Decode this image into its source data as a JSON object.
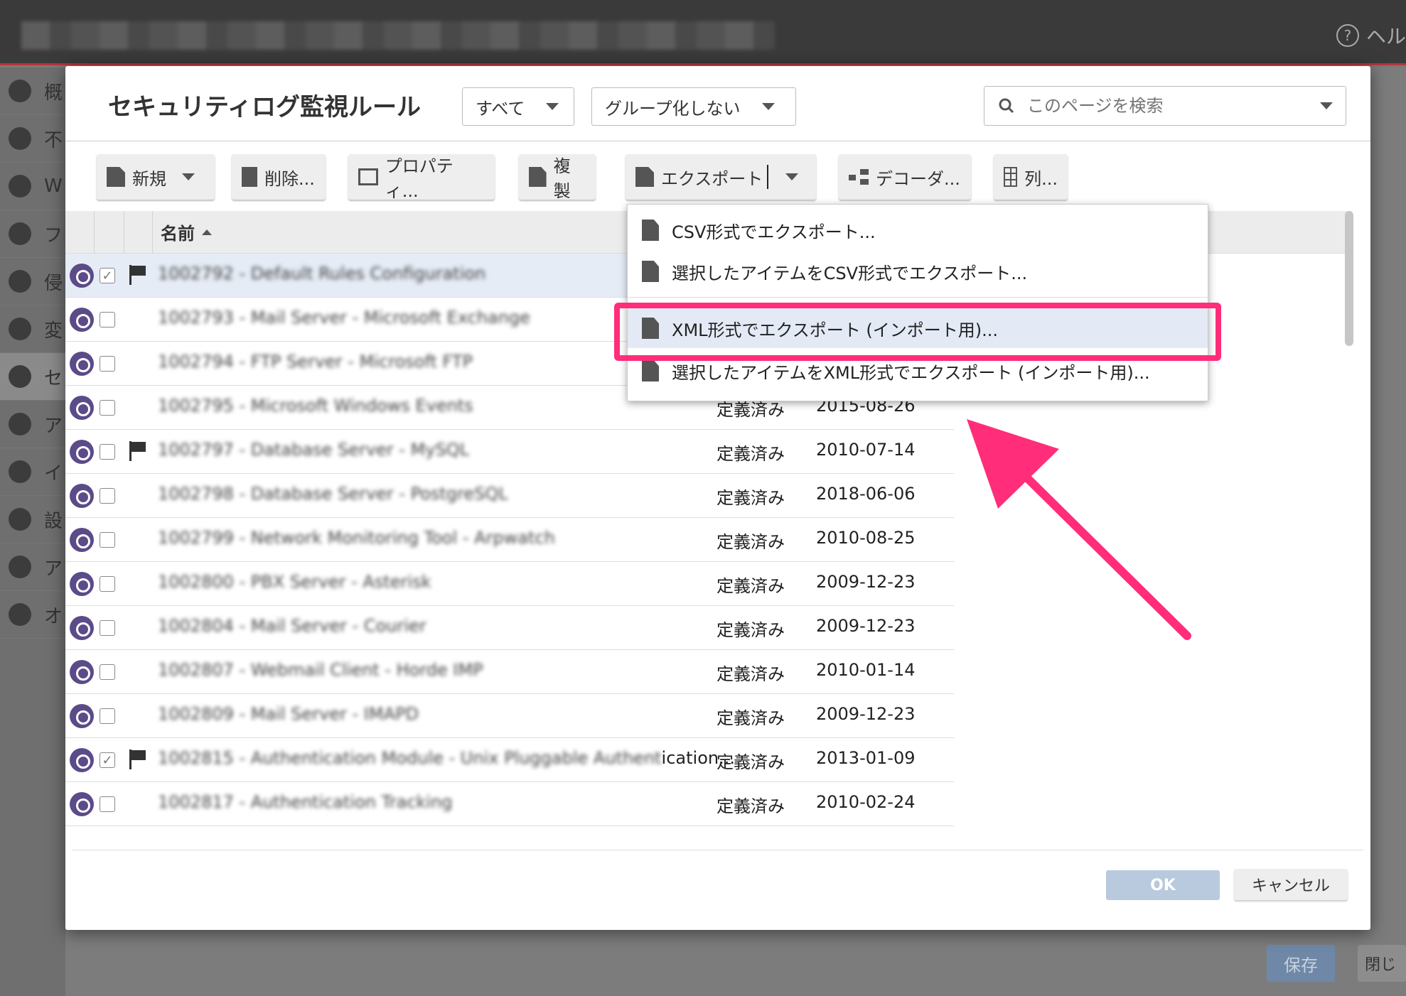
{
  "topbar": {
    "help_label": "ヘル"
  },
  "leftnav": {
    "items": [
      "概",
      "不",
      "W",
      "フ",
      "侵",
      "変",
      "セ",
      "ア",
      "イ",
      "設",
      "ア",
      "オ"
    ]
  },
  "background": {
    "save_label": "保存",
    "close_label": "閉じ"
  },
  "dialog": {
    "title": "セキュリティログ監視ルール",
    "filter_value": "すべて",
    "group_value": "グループ化しない",
    "search_placeholder": "このページを検索"
  },
  "toolbar": {
    "new_label": "新規",
    "delete_label": "削除...",
    "properties_label": "プロパティ...",
    "duplicate_label": "複製",
    "export_label": "エクスポート",
    "decoder_label": "デコーダ...",
    "columns_label": "列..."
  },
  "table": {
    "name_header": "名前",
    "rows": [
      {
        "name": "1002792 - Default Rules Configuration",
        "status": "",
        "date": "",
        "checked": true,
        "flag": true
      },
      {
        "name": "1002793 - Mail Server - Microsoft Exchange",
        "status": "",
        "date": "",
        "checked": false,
        "flag": false
      },
      {
        "name": "1002794 - FTP Server - Microsoft FTP",
        "status": "",
        "date": "",
        "checked": false,
        "flag": false
      },
      {
        "name": "1002795 - Microsoft Windows Events",
        "status": "定義済み",
        "date": "2015-08-26",
        "checked": false,
        "flag": false
      },
      {
        "name": "1002797 - Database Server - MySQL",
        "status": "定義済み",
        "date": "2010-07-14",
        "checked": false,
        "flag": true
      },
      {
        "name": "1002798 - Database Server - PostgreSQL",
        "status": "定義済み",
        "date": "2018-06-06",
        "checked": false,
        "flag": false
      },
      {
        "name": "1002799 - Network Monitoring Tool - Arpwatch",
        "status": "定義済み",
        "date": "2010-08-25",
        "checked": false,
        "flag": false
      },
      {
        "name": "1002800 - PBX Server - Asterisk",
        "status": "定義済み",
        "date": "2009-12-23",
        "checked": false,
        "flag": false
      },
      {
        "name": "1002804 - Mail Server - Courier",
        "status": "定義済み",
        "date": "2009-12-23",
        "checked": false,
        "flag": false
      },
      {
        "name": "1002807 - Webmail Client - Horde IMP",
        "status": "定義済み",
        "date": "2010-01-14",
        "checked": false,
        "flag": false
      },
      {
        "name": "1002809 - Mail Server - IMAPD",
        "status": "定義済み",
        "date": "2009-12-23",
        "checked": false,
        "flag": false
      },
      {
        "name": "1002815 - Authentication Module - Unix Pluggable Authent",
        "name_suffix": "ication...",
        "status": "定義済み",
        "date": "2013-01-09",
        "checked": true,
        "flag": true
      },
      {
        "name": "1002817 - Authentication Tracking",
        "status": "定義済み",
        "date": "2010-02-24",
        "checked": false,
        "flag": false
      }
    ]
  },
  "export_menu": {
    "items": [
      "CSV形式でエクスポート...",
      "選択したアイテムをCSV形式でエクスポート...",
      "XML形式でエクスポート (インポート用)...",
      "選択したアイテムをXML形式でエクスポート (インポート用)..."
    ],
    "highlighted_index": 2
  },
  "buttons": {
    "ok_label": "OK",
    "cancel_label": "キャンセル"
  },
  "annotation_color": "#ff2d7a"
}
